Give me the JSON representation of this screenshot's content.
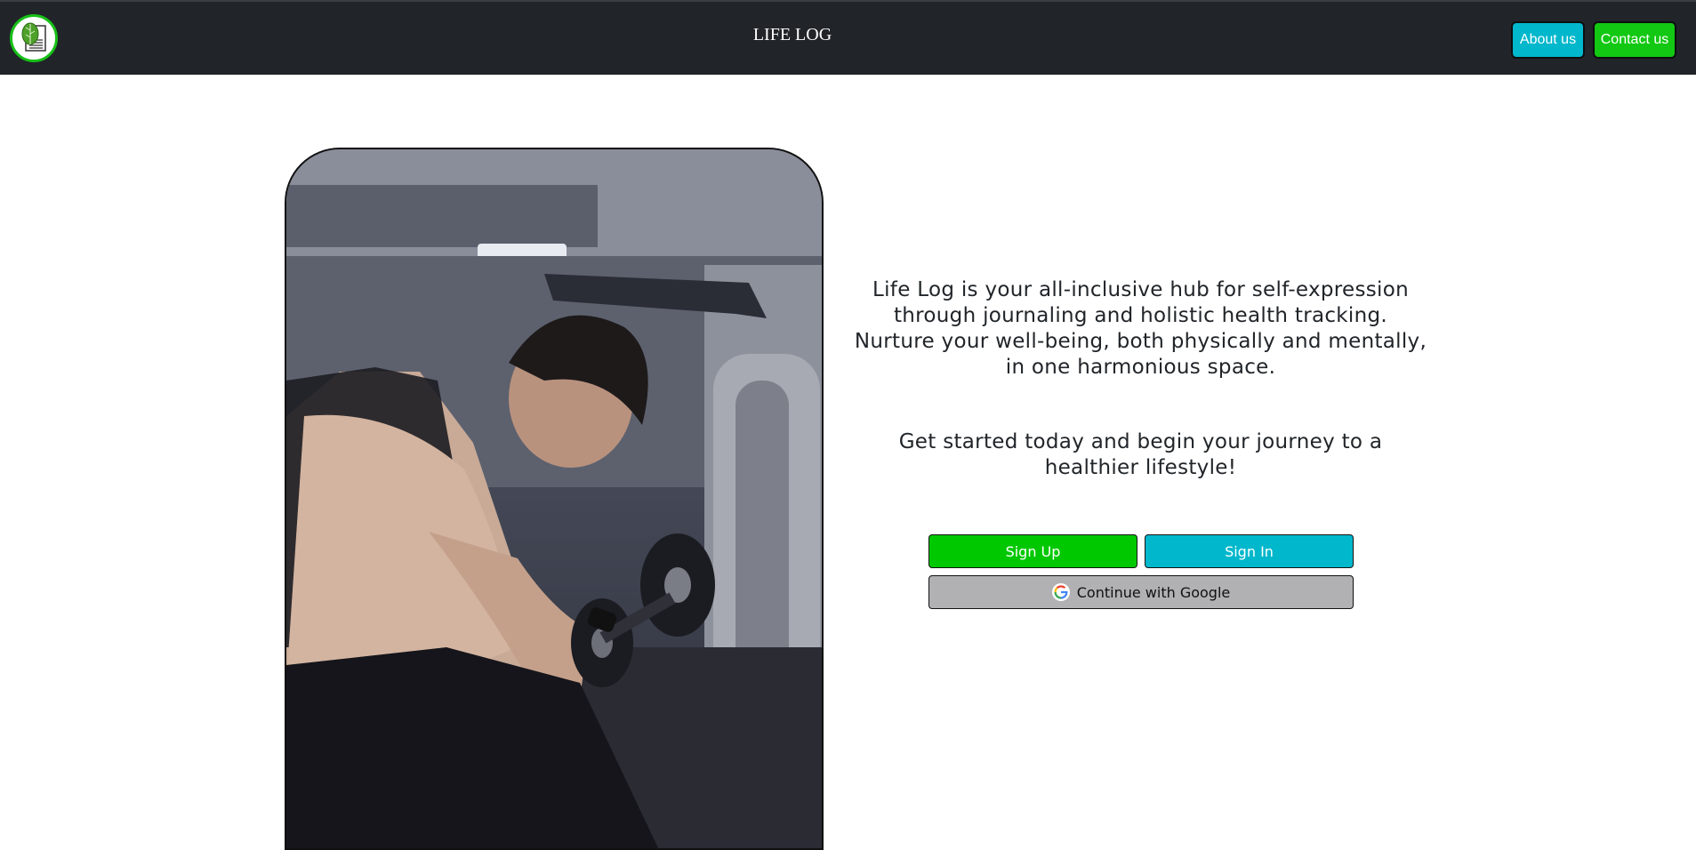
{
  "navbar": {
    "brand": "LIFE LOG",
    "logo_icon": "journal-leaf-logo",
    "about_label": "About us",
    "contact_label": "Contact us"
  },
  "hero": {
    "image": "man-lifting-dumbbell-gym-photo",
    "intro": "Life Log is your all-inclusive hub for self-expression through journaling and holistic health tracking. Nurture your well-being, both physically and mentally, in one harmonious space.",
    "cta": "Get started today and begin your journey to a healthier lifestyle!"
  },
  "actions": {
    "signup_label": "Sign Up",
    "signin_label": "Sign In",
    "google_label": "Continue with Google",
    "google_icon": "google-g-icon"
  },
  "colors": {
    "navbar_bg": "#212529",
    "about_bg": "#00b7cc",
    "contact_bg": "#12c812",
    "signup_bg": "#00c800",
    "signin_bg": "#00b7cc",
    "google_bg": "#b1b0b2"
  }
}
